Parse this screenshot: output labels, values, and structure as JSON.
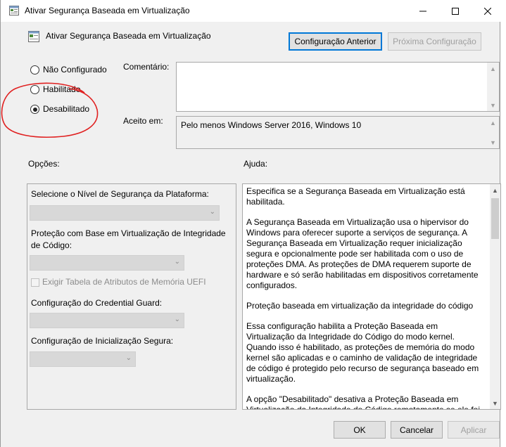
{
  "window": {
    "title": "Ativar Segurança Baseada em Virtualização",
    "controls": [
      "minimize",
      "maximize",
      "close"
    ]
  },
  "header": {
    "policy_name": "Ativar Segurança Baseada em Virtualização",
    "prev_button": "Configuração Anterior",
    "next_button": "Próxima Configuração"
  },
  "state_options": {
    "not_configured": "Não Configurado",
    "enabled": "Habilitado",
    "disabled": "Desabilitado",
    "selected": "disabled"
  },
  "comment": {
    "label": "Comentário:",
    "value": ""
  },
  "supported": {
    "label": "Aceito em:",
    "value": "Pelo menos Windows Server 2016, Windows 10"
  },
  "options": {
    "label": "Opções:",
    "platform_label": "Selecione o Nível de Segurança da Plataforma:",
    "hvci_label": "Proteção com Base em Virtualização de Integridade de Código:",
    "uefi_table_label": "Exigir Tabela de Atributos de Memória UEFI",
    "credential_guard_label": "Configuração do Credential Guard:",
    "secure_launch_label": "Configuração de Inicialização Segura:"
  },
  "help": {
    "label": "Ajuda:",
    "paragraphs": [
      "Especifica se a Segurança Baseada em Virtualização está habilitada.",
      "A Segurança Baseada em Virtualização usa o hipervisor do Windows para oferecer suporte a serviços de segurança. A Segurança Baseada em Virtualização requer inicialização segura e opcionalmente pode ser habilitada com o uso de proteções DMA. As proteções de DMA requerem suporte de hardware e só serão habilitadas em dispositivos corretamente configurados.",
      "Proteção baseada em virtualização da integridade do código",
      "Essa configuração habilita a Proteção Baseada em Virtualização da Integridade do Código do modo kernel. Quando isso é habilitado, as proteções de memória do modo kernel são aplicadas e o caminho de validação de integridade de código é protegido pelo recurso de segurança baseado em virtualização.",
      "A opção \"Desabilitado\" desativa a Proteção Baseada em Virtualização da Integridade do Código remotamente se ele foi ativado anteriormente com a opção \"Habilitado sem bloqueio\"."
    ]
  },
  "footer": {
    "ok": "OK",
    "cancel": "Cancelar",
    "apply": "Aplicar"
  },
  "colors": {
    "annotation": "#e02020",
    "focus_border": "#0078d7"
  }
}
